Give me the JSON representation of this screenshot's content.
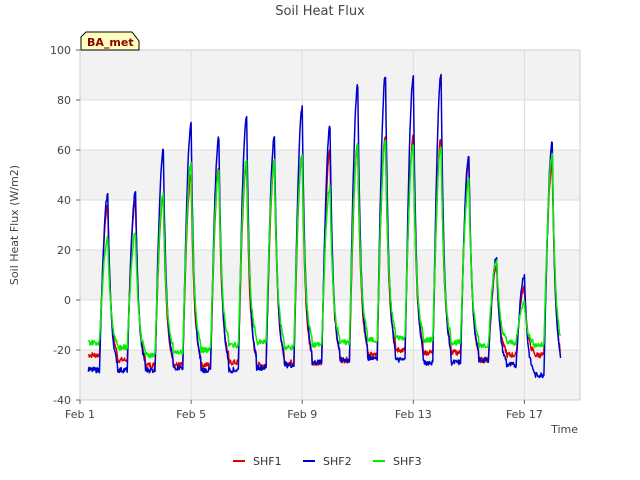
{
  "chart_data": {
    "type": "line",
    "title": "Soil Heat Flux",
    "xlabel": "Time",
    "ylabel": "Soil Heat Flux (W/m2)",
    "badge": "BA_met",
    "ylim": [
      -40,
      100
    ],
    "xlim": [
      1,
      19
    ],
    "y_ticks": [
      -40,
      -20,
      0,
      20,
      40,
      60,
      80,
      100
    ],
    "x_ticks": [
      {
        "value": 1,
        "label": "Feb 1"
      },
      {
        "value": 5,
        "label": "Feb 5"
      },
      {
        "value": 9,
        "label": "Feb 9"
      },
      {
        "value": 13,
        "label": "Feb 13"
      },
      {
        "value": 17,
        "label": "Feb 17"
      }
    ],
    "grid": true,
    "legend_position": "bottom",
    "days": [
      1.85,
      2.85,
      3.85,
      4.85,
      5.85,
      6.85,
      7.85,
      8.85,
      9.85,
      10.85,
      11.85,
      12.85,
      13.85,
      14.85,
      15.85,
      16.85,
      17.85
    ],
    "series": [
      {
        "name": "SHF1",
        "color": "#dd0000",
        "base": -22,
        "troughs": [
          -24,
          -26,
          -26,
          -26,
          -25,
          -26,
          -25,
          -25,
          -24,
          -22,
          -20,
          -21,
          -21,
          -24,
          -22,
          -22,
          -26
        ],
        "peaks": [
          38,
          40,
          42,
          50,
          52,
          55,
          55,
          58,
          60,
          62,
          66,
          65,
          65,
          55,
          14,
          5,
          55
        ]
      },
      {
        "name": "SHF2",
        "color": "#0000cc",
        "base": -28,
        "troughs": [
          -28,
          -28,
          -27,
          -28,
          -28,
          -27,
          -26,
          -25,
          -24,
          -23,
          -24,
          -25,
          -25,
          -24,
          -26,
          -30,
          -29
        ],
        "peaks": [
          42,
          43,
          60,
          70,
          65,
          74,
          65,
          77,
          69,
          86,
          90,
          89,
          90,
          58,
          17,
          10,
          63
        ]
      },
      {
        "name": "SHF3",
        "color": "#00ee00",
        "base": -17,
        "troughs": [
          -19,
          -22,
          -21,
          -20,
          -18,
          -17,
          -19,
          -18,
          -17,
          -16,
          -15,
          -16,
          -17,
          -18,
          -17,
          -18,
          -20
        ],
        "peaks": [
          25,
          27,
          42,
          54,
          52,
          56,
          55,
          58,
          45,
          62,
          64,
          62,
          62,
          48,
          16,
          -1,
          58
        ]
      }
    ]
  }
}
